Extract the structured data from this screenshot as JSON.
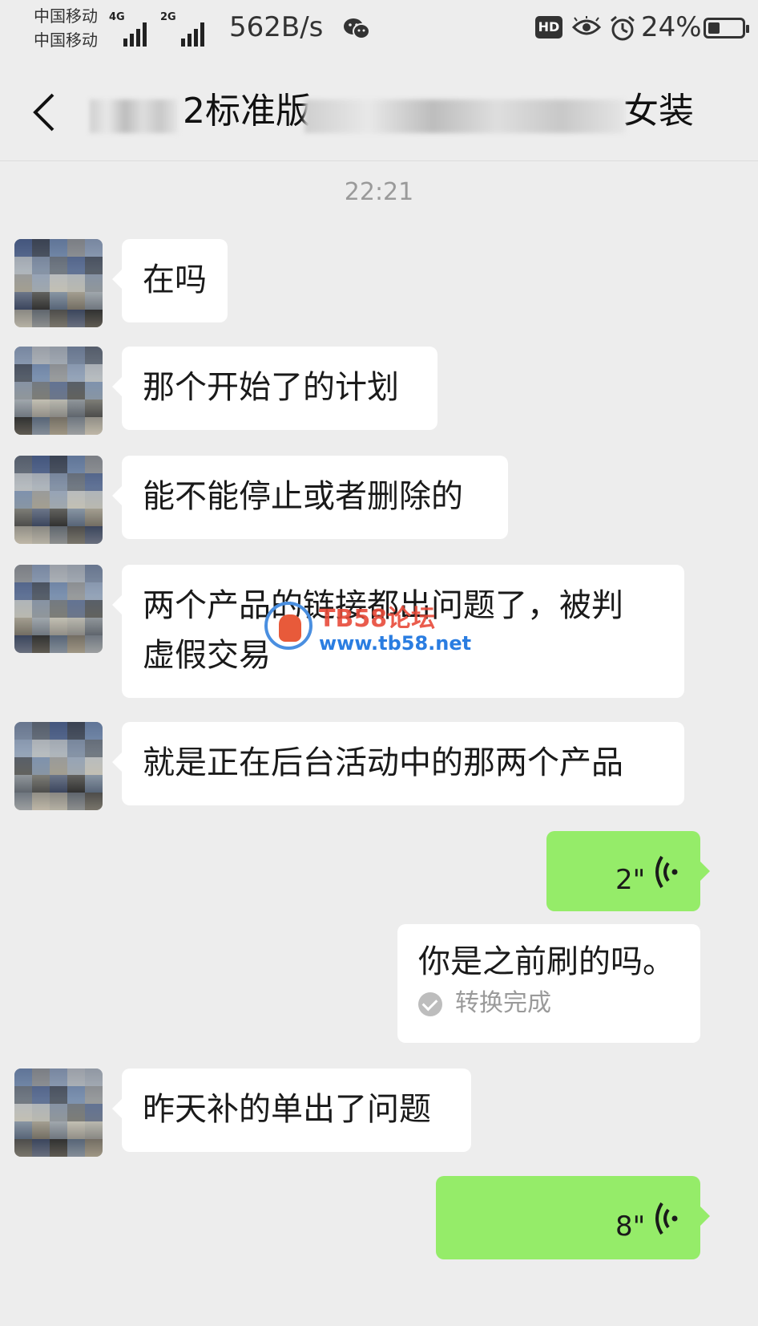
{
  "status_bar": {
    "carrier_1": "中国移动",
    "carrier_2": "中国移动",
    "network_1": "4G",
    "network_2": "2G",
    "net_speed": "562B/s",
    "hd_badge": "HD",
    "battery": "24%"
  },
  "header": {
    "title_visible_mid": "2标准版",
    "title_visible_end": "女装"
  },
  "chat": {
    "timestamp": "22:21",
    "messages": [
      {
        "side": "left",
        "text": "在吗"
      },
      {
        "side": "left",
        "text": "那个开始了的计划"
      },
      {
        "side": "left",
        "text": "能不能停止或者删除的"
      },
      {
        "side": "left",
        "line1": "两个产品的链接都出问题了，被判",
        "line2": "虚假交易"
      },
      {
        "side": "left",
        "text": "就是正在后台活动中的那两个产品"
      },
      {
        "side": "right",
        "type": "voice",
        "duration": "2\""
      },
      {
        "side": "right",
        "type": "transcript",
        "text": "你是之前刷的吗。",
        "status": "转换完成"
      },
      {
        "side": "left",
        "text": "昨天补的单出了问题"
      },
      {
        "side": "right",
        "type": "voice",
        "duration": "8\""
      }
    ]
  },
  "watermark": {
    "title": "TB58论坛",
    "url": "www.tb58.net"
  },
  "colors": {
    "background": "#ededed",
    "bubble_in": "#ffffff",
    "bubble_out": "#95ec69",
    "watermark_red": "#e84b3a",
    "watermark_blue": "#2a7de1"
  }
}
